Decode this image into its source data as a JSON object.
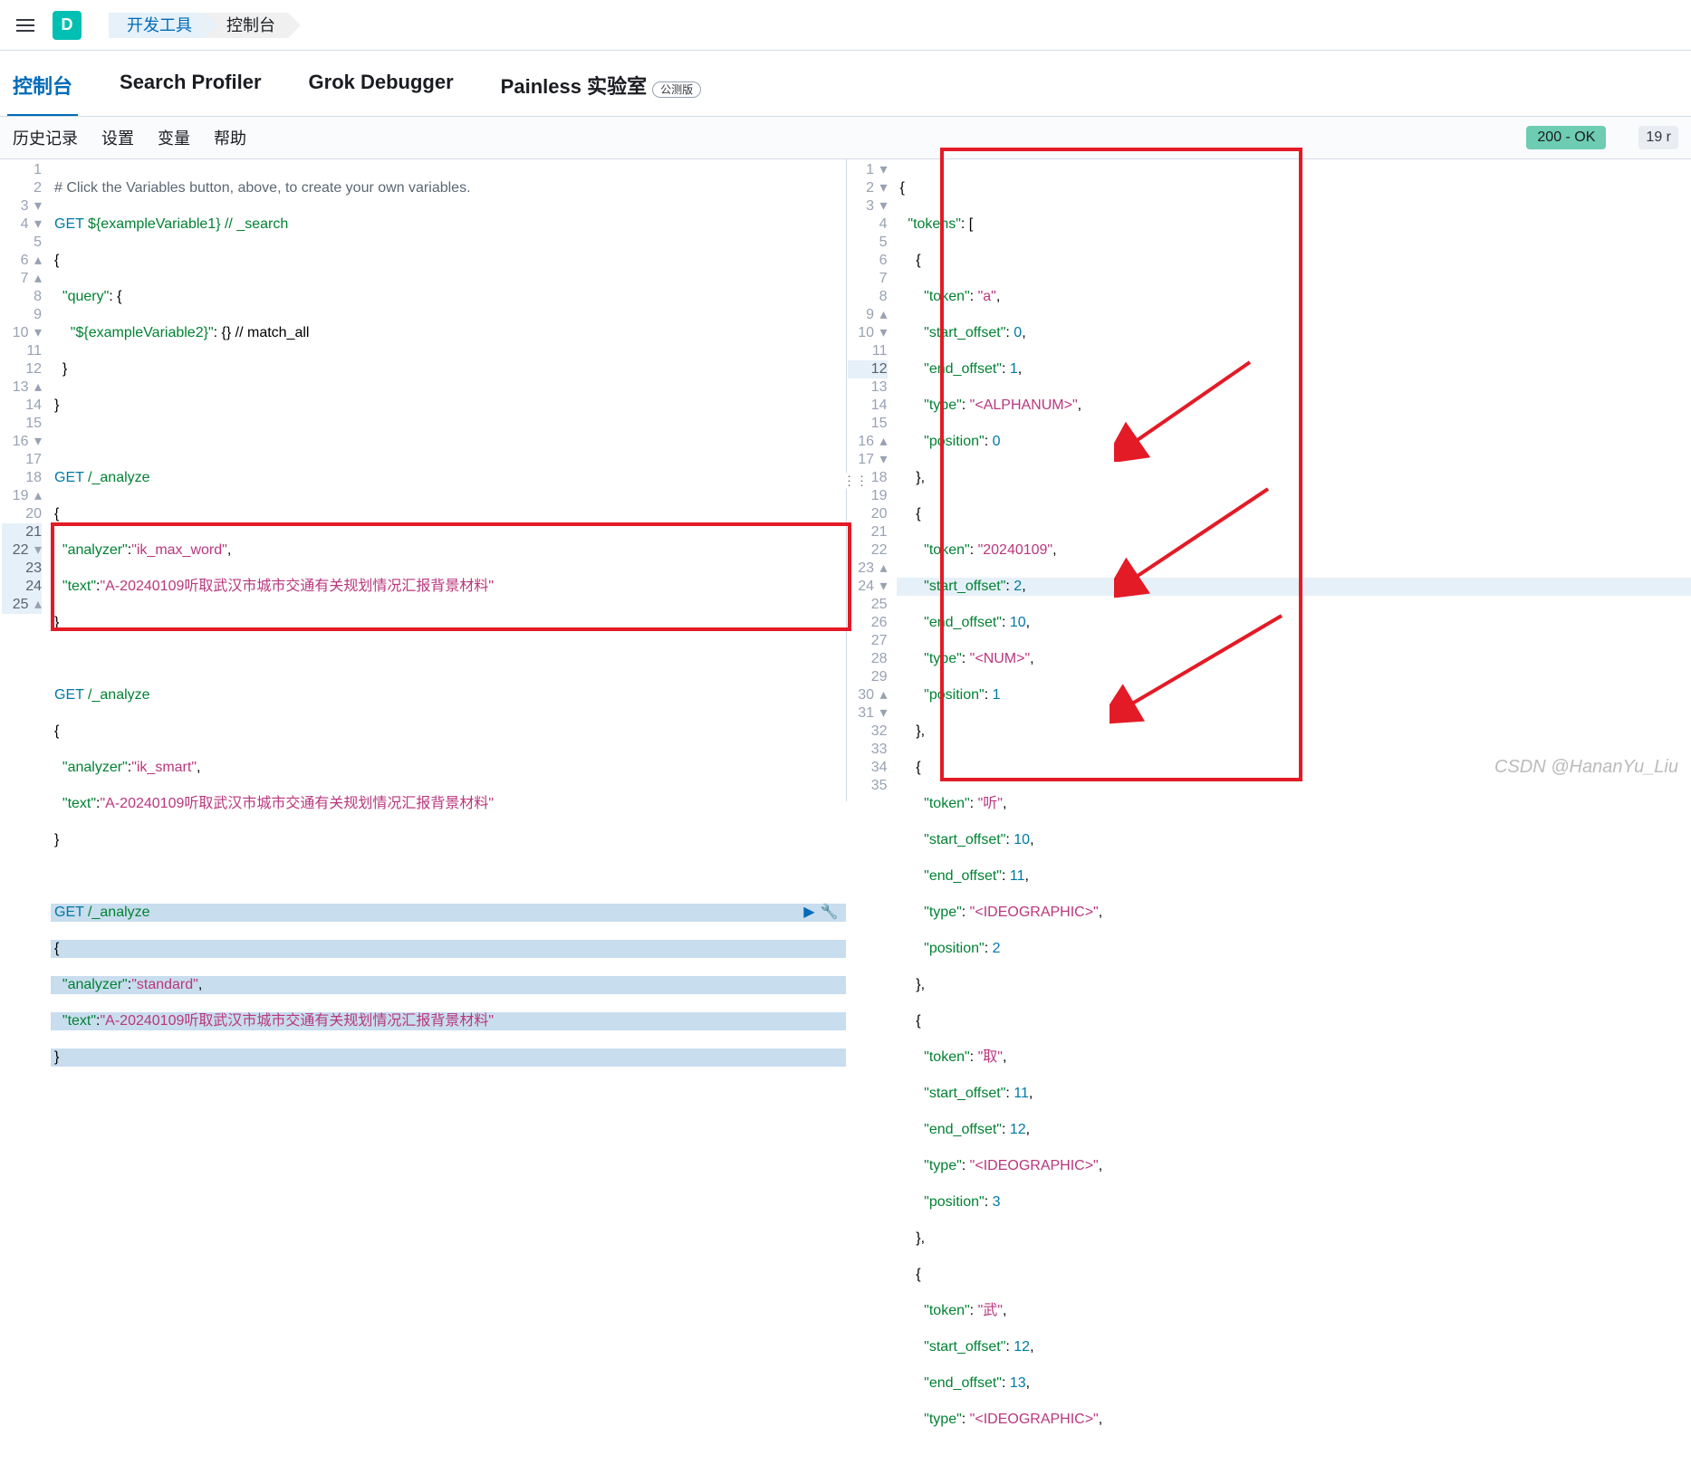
{
  "header": {
    "logo": "D",
    "crumb1": "开发工具",
    "crumb2": "控制台"
  },
  "tabs": {
    "t1": "控制台",
    "t2": "Search Profiler",
    "t3": "Grok Debugger",
    "t4": "Painless 实验室",
    "beta": "公测版"
  },
  "toolbar": {
    "history": "历史记录",
    "settings": "设置",
    "variables": "变量",
    "help": "帮助",
    "status": "200 - OK",
    "time": "19 r"
  },
  "editor": {
    "l1_comment": "# Click the Variables button, above, to create your own variables.",
    "l2_method": "GET",
    "l2_url": " ${exampleVariable1} // _search",
    "l3": "{",
    "l4_key": "\"query\"",
    "l4_rest": ": {",
    "l5_key": "\"${exampleVariable2}\"",
    "l5_rest": ": {} // match_all",
    "l6": "  }",
    "l7": "}",
    "l9_method": "GET",
    "l9_url": " /_analyze",
    "l10": "{",
    "l11_k": "\"analyzer\"",
    "l11_v": "\"ik_max_word\"",
    "l12_k": "\"text\"",
    "l12_v": "\"A-20240109听取武汉市城市交通有关规划情况汇报背景材料\"",
    "l13": "}",
    "l15_method": "GET",
    "l15_url": " /_analyze",
    "l16": "{",
    "l17_k": "\"analyzer\"",
    "l17_v": "\"ik_smart\"",
    "l18_k": "\"text\"",
    "l18_v": "\"A-20240109听取武汉市城市交通有关规划情况汇报背景材料\"",
    "l19": "}",
    "l21_method": "GET",
    "l21_url": " /_analyze",
    "l22": "{",
    "l23_k": "\"analyzer\"",
    "l23_v": "\"standard\"",
    "l24_k": "\"text\"",
    "l24_v": "\"A-20240109听取武汉市城市交通有关规划情况汇报背景材料\"",
    "l25": "}"
  },
  "output": {
    "l1": "{",
    "l2_k": "\"tokens\"",
    "l2_v": ": [",
    "l3": "    {",
    "l4_k": "\"token\"",
    "l4_v": "\"a\"",
    "l5_k": "\"start_offset\"",
    "l5_v": "0",
    "l6_k": "\"end_offset\"",
    "l6_v": "1",
    "l7_k": "\"type\"",
    "l7_v": "\"<ALPHANUM>\"",
    "l8_k": "\"position\"",
    "l8_v": "0",
    "l9": "    },",
    "l10": "    {",
    "l11_k": "\"token\"",
    "l11_v": "\"20240109\"",
    "l12_k": "\"start_offset\"",
    "l12_v": "2",
    "l13_k": "\"end_offset\"",
    "l13_v": "10",
    "l14_k": "\"type\"",
    "l14_v": "\"<NUM>\"",
    "l15_k": "\"position\"",
    "l15_v": "1",
    "l16": "    },",
    "l17": "    {",
    "l18_k": "\"token\"",
    "l18_v": "\"听\"",
    "l19_k": "\"start_offset\"",
    "l19_v": "10",
    "l20_k": "\"end_offset\"",
    "l20_v": "11",
    "l21_k": "\"type\"",
    "l21_v": "\"<IDEOGRAPHIC>\"",
    "l22_k": "\"position\"",
    "l22_v": "2",
    "l23": "    },",
    "l24": "    {",
    "l25_k": "\"token\"",
    "l25_v": "\"取\"",
    "l26_k": "\"start_offset\"",
    "l26_v": "11",
    "l27_k": "\"end_offset\"",
    "l27_v": "12",
    "l28_k": "\"type\"",
    "l28_v": "\"<IDEOGRAPHIC>\"",
    "l29_k": "\"position\"",
    "l29_v": "3",
    "l30": "    },",
    "l31": "    {",
    "l32_k": "\"token\"",
    "l32_v": "\"武\"",
    "l33_k": "\"start_offset\"",
    "l33_v": "12",
    "l34_k": "\"end_offset\"",
    "l34_v": "13",
    "l35_k": "\"type\"",
    "l35_v": "\"<IDEOGRAPHIC>\""
  },
  "watermark": "CSDN @HananYu_Liu"
}
